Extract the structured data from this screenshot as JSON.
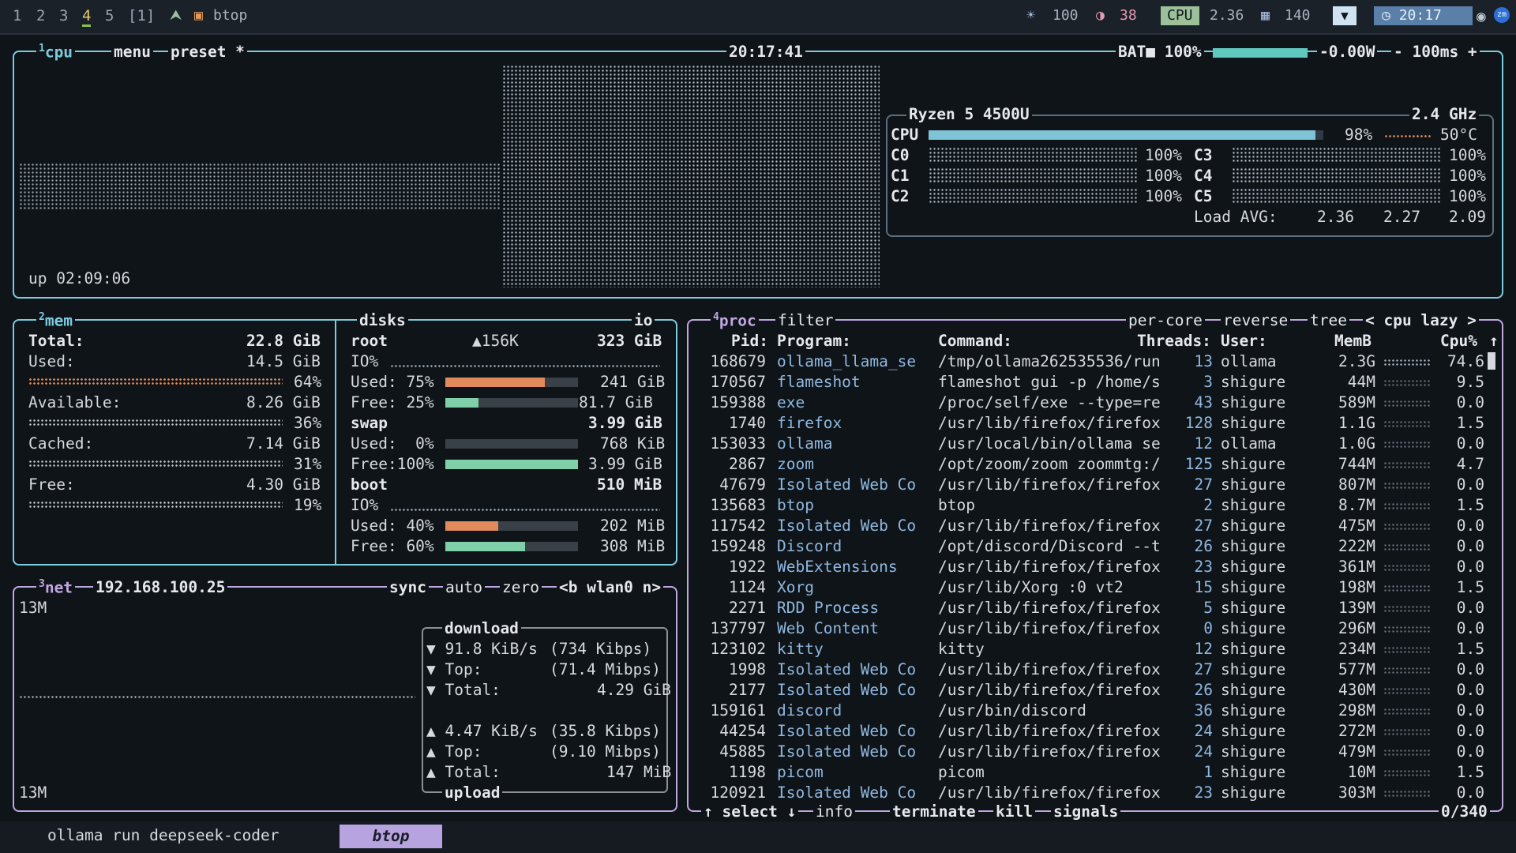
{
  "topbar": {
    "workspaces": [
      "1",
      "2",
      "3",
      "4",
      "5",
      "[1]"
    ],
    "active_workspace_index": 3,
    "window_title": "btop",
    "indicators": {
      "brightness": "100",
      "volume": "38",
      "cpu_label": "CPU",
      "cpu_value": "2.36",
      "memory": "140",
      "time": "20:17"
    }
  },
  "cpu_panel": {
    "tab_number": "1",
    "title": "cpu",
    "menu": "menu",
    "preset": "preset *",
    "clock": "20:17:41",
    "battery": "BAT■ 100%",
    "battery_level": 1.0,
    "power": "-0.00W",
    "update_interval": "- 100ms +",
    "uptime": "up 02:09:06",
    "cpu_name": "Ryzen 5 4500U",
    "freq": "2.4 GHz",
    "total_label": "CPU",
    "total_pct": "98%",
    "total_level": 0.98,
    "temp": "50°C",
    "cores": [
      {
        "name": "C0",
        "pct": "100%"
      },
      {
        "name": "C1",
        "pct": "100%"
      },
      {
        "name": "C2",
        "pct": "100%"
      },
      {
        "name": "C3",
        "pct": "100%"
      },
      {
        "name": "C4",
        "pct": "100%"
      },
      {
        "name": "C5",
        "pct": "100%"
      }
    ],
    "load_label": "Load AVG:",
    "load": [
      "2.36",
      "2.27",
      "2.09"
    ]
  },
  "mem_panel": {
    "tab_number": "2",
    "title": "mem",
    "total_label": "Total:",
    "total": "22.8 GiB",
    "rows": [
      {
        "label": "Used:",
        "value": "14.5 GiB",
        "pct": "64%",
        "level": 0.64,
        "color": "orange"
      },
      {
        "label": "Available:",
        "value": "8.26 GiB",
        "pct": "36%",
        "level": 0.36,
        "color": "white"
      },
      {
        "label": "Cached:",
        "value": "7.14 GiB",
        "pct": "31%",
        "level": 0.31,
        "color": "white"
      },
      {
        "label": "Free:",
        "value": "4.30 GiB",
        "pct": "19%",
        "level": 0.19,
        "color": "white"
      }
    ]
  },
  "disks_panel": {
    "title": "disks",
    "io": "io",
    "root_name": "root",
    "root_io_speed": "▲156K",
    "root_size": "323 GiB",
    "root_io": "IO%",
    "root_used_label": "Used: 75%",
    "root_used_level": 0.75,
    "root_used": "241 GiB",
    "root_free_label": "Free: 25%",
    "root_free_level": 0.25,
    "root_free": "81.7 GiB",
    "swap_name": "swap",
    "swap_size": "3.99 GiB",
    "swap_used_label": "Used:  0%",
    "swap_used_level": 0.0,
    "swap_used": "768 KiB",
    "swap_free_label": "Free:100%",
    "swap_free_level": 1.0,
    "swap_free": "3.99 GiB",
    "boot_name": "boot",
    "boot_size": "510 MiB",
    "boot_io": "IO%",
    "boot_used_label": "Used: 40%",
    "boot_used_level": 0.4,
    "boot_used": "202 MiB",
    "boot_free_label": "Free: 60%",
    "boot_free_level": 0.6,
    "boot_free": "308 MiB"
  },
  "net_panel": {
    "tab_number": "3",
    "title": "net",
    "ip": "192.168.100.25",
    "sync": "sync",
    "auto": "auto",
    "zero": "zero",
    "iface": "<b wlan0 n>",
    "scale_top": "13M",
    "scale_bottom": "13M",
    "download_title": "download",
    "dl_rate": "▼ 91.8 KiB/s",
    "dl_rate_bits": "(734 Kibps)",
    "dl_top_label": "▼ Top:",
    "dl_top": "(71.4 Mibps)",
    "dl_total_label": "▼ Total:",
    "dl_total": "4.29 GiB",
    "ul_rate": "▲ 4.47 KiB/s",
    "ul_rate_bits": "(35.8 Kibps)",
    "ul_top_label": "▲ Top:",
    "ul_top": "(9.10 Mibps)",
    "ul_total_label": "▲ Total:",
    "ul_total": "147 MiB",
    "upload_title": "upload"
  },
  "proc_panel": {
    "tab_number": "4",
    "title": "proc",
    "filter": "filter",
    "per_core": "per-core",
    "reverse": "reverse",
    "tree": "tree",
    "sort": "< cpu lazy >",
    "columns": [
      "Pid:",
      "Program:",
      "Command:",
      "Threads:",
      "User:",
      "MemB",
      "Cpu%"
    ],
    "rows": [
      [
        "168679",
        "ollama_llama_se",
        "/tmp/ollama262535536/run",
        "13",
        "ollama",
        "2.3G",
        "74.6"
      ],
      [
        "170567",
        "flameshot",
        "flameshot gui -p /home/s",
        "3",
        "shigure",
        "44M",
        "9.5"
      ],
      [
        "159388",
        "exe",
        "/proc/self/exe --type=re",
        "43",
        "shigure",
        "589M",
        "0.0"
      ],
      [
        "1740",
        "firefox",
        "/usr/lib/firefox/firefox",
        "128",
        "shigure",
        "1.1G",
        "1.5"
      ],
      [
        "153033",
        "ollama",
        "/usr/local/bin/ollama se",
        "12",
        "ollama",
        "1.0G",
        "0.0"
      ],
      [
        "2867",
        "zoom",
        "/opt/zoom/zoom zoommtg:/",
        "125",
        "shigure",
        "744M",
        "4.7"
      ],
      [
        "47679",
        "Isolated Web Co",
        "/usr/lib/firefox/firefox",
        "27",
        "shigure",
        "807M",
        "0.0"
      ],
      [
        "135683",
        "btop",
        "btop",
        "2",
        "shigure",
        "8.7M",
        "1.5"
      ],
      [
        "117542",
        "Isolated Web Co",
        "/usr/lib/firefox/firefox",
        "27",
        "shigure",
        "475M",
        "0.0"
      ],
      [
        "159248",
        "Discord",
        "/opt/discord/Discord --t",
        "26",
        "shigure",
        "222M",
        "0.0"
      ],
      [
        "1922",
        "WebExtensions",
        "/usr/lib/firefox/firefox",
        "23",
        "shigure",
        "361M",
        "0.0"
      ],
      [
        "1124",
        "Xorg",
        "/usr/lib/Xorg :0 vt2",
        "15",
        "shigure",
        "198M",
        "1.5"
      ],
      [
        "2271",
        "RDD Process",
        "/usr/lib/firefox/firefox",
        "5",
        "shigure",
        "139M",
        "0.0"
      ],
      [
        "137797",
        "Web Content",
        "/usr/lib/firefox/firefox",
        "0",
        "shigure",
        "296M",
        "0.0"
      ],
      [
        "123102",
        "kitty",
        "kitty",
        "12",
        "shigure",
        "234M",
        "1.5"
      ],
      [
        "1998",
        "Isolated Web Co",
        "/usr/lib/firefox/firefox",
        "27",
        "shigure",
        "577M",
        "0.0"
      ],
      [
        "2177",
        "Isolated Web Co",
        "/usr/lib/firefox/firefox",
        "26",
        "shigure",
        "430M",
        "0.0"
      ],
      [
        "159161",
        "discord",
        "/usr/bin/discord",
        "36",
        "shigure",
        "298M",
        "0.0"
      ],
      [
        "44254",
        "Isolated Web Co",
        "/usr/lib/firefox/firefox",
        "24",
        "shigure",
        "272M",
        "0.0"
      ],
      [
        "45885",
        "Isolated Web Co",
        "/usr/lib/firefox/firefox",
        "24",
        "shigure",
        "479M",
        "0.0"
      ],
      [
        "1198",
        "picom",
        "picom",
        "1",
        "shigure",
        "10M",
        "1.5"
      ],
      [
        "120921",
        "Isolated Web Co",
        "/usr/lib/firefox/firefox",
        "23",
        "shigure",
        "303M",
        "0.0"
      ]
    ],
    "footer": {
      "select": "↑ select ↓",
      "info": "info",
      "terminate": "terminate",
      "kill": "kill",
      "signals": "signals",
      "count": "0/340"
    }
  },
  "taskbar": {
    "command": "ollama run deepseek-coder",
    "active_tab": "btop"
  },
  "colors": {
    "accent_cyan": "#7ccce0",
    "accent_purple": "#c1a7e2",
    "program_blue": "#8fb8e0",
    "orange": "#e28a5c",
    "green": "#7fd0a8"
  }
}
